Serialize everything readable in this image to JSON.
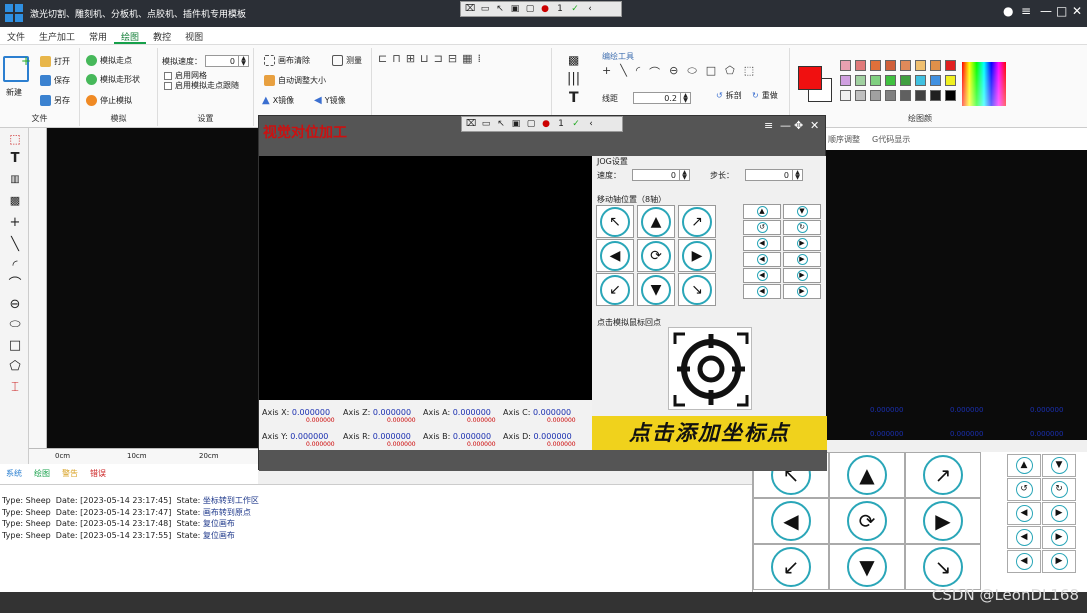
{
  "titlebar": {
    "title": "激光切割、雕刻机、分板机、点胶机、插件机专用模板",
    "qt_counter": "1"
  },
  "menu": [
    "文件",
    "生产加工",
    "常用",
    "绘图",
    "教控",
    "视图"
  ],
  "menu_active": "绘图",
  "ribbon": {
    "file_group": {
      "new": "新建",
      "open": "打开",
      "save": "保存",
      "saveas": "另存",
      "label": "文件"
    },
    "sim_group": {
      "sim_walk": "模拟走点",
      "sim_shape": "模拟走形状",
      "stop_sim": "停止模拟",
      "label": "模拟"
    },
    "settings_group": {
      "sim_speed_label": "模拟速度：",
      "sim_speed_value": "0",
      "grid": "启用网格",
      "trace": "启用模拟走点跟随",
      "label": "设置"
    },
    "canvas_group": {
      "clear": "画布清除",
      "measure": "测量",
      "auto_fit": "自动调整大小",
      "x_mirror": "X镜像",
      "y_mirror": "Y镜像"
    },
    "draw_tools": {
      "label": "编绘工具",
      "line_width_label": "线距",
      "line_width_value": "0.2",
      "break": "拆剖",
      "redo": "重做"
    },
    "palette_label": "绘图颜"
  },
  "ruler": {
    "t0": "0cm",
    "t1": "10cm",
    "t2": "20cm"
  },
  "bottom_tabs": [
    "系统",
    "绘图",
    "警告",
    "错误"
  ],
  "log": [
    {
      "type": "Sheep",
      "date": "[2023-05-14 23:17:45]",
      "state": "坐标转到工作区"
    },
    {
      "type": "Sheep",
      "date": "[2023-05-14 23:17:47]",
      "state": "画布转到原点"
    },
    {
      "type": "Sheep",
      "date": "[2023-05-14 23:17:48]",
      "state": "复位画布"
    },
    {
      "type": "Sheep",
      "date": "[2023-05-14 23:17:55]",
      "state": "复位画布"
    }
  ],
  "log_labels": {
    "type": "Type:",
    "date": "Date:",
    "state": "State:"
  },
  "right_tabs": [
    "顺序调整",
    "G代码显示"
  ],
  "right_values": {
    "v1": "0.000000",
    "v2": "0.000000",
    "v3": "0.000000",
    "v4": "0.000000",
    "v5": "0.000000",
    "v6": "0.000000"
  },
  "dialog": {
    "title": "视觉对位加工",
    "axes": [
      {
        "label": "Axis X:",
        "value": "0.000000",
        "sub": "0.000000"
      },
      {
        "label": "Axis Z:",
        "value": "0.000000",
        "sub": "0.000000"
      },
      {
        "label": "Axis A:",
        "value": "0.000000",
        "sub": "0.000000"
      },
      {
        "label": "Axis C:",
        "value": "0.000000",
        "sub": "0.000000"
      },
      {
        "label": "Axis Y:",
        "value": "0.000000",
        "sub": "0.000000"
      },
      {
        "label": "Axis R:",
        "value": "0.000000",
        "sub": "0.000000"
      },
      {
        "label": "Axis B:",
        "value": "0.000000",
        "sub": "0.000000"
      },
      {
        "label": "Axis D:",
        "value": "0.000000",
        "sub": "0.000000"
      }
    ],
    "jog": {
      "title": "JOG设置",
      "speed_label": "速度：",
      "speed_value": "0",
      "step_label": "步长：",
      "step_value": "0"
    },
    "move_title": "移动轴位置（8轴）",
    "target_title": "点击模拟鼠标回点",
    "add_point": "点击添加坐标点"
  },
  "watermark": "CSDN @LeonDL168",
  "colors": {
    "accent": "#16a04a",
    "title_red": "#cc1010",
    "yellow": "#f0d21c",
    "ring": "#2aa6b8",
    "value_blue": "#1a2fb0"
  }
}
